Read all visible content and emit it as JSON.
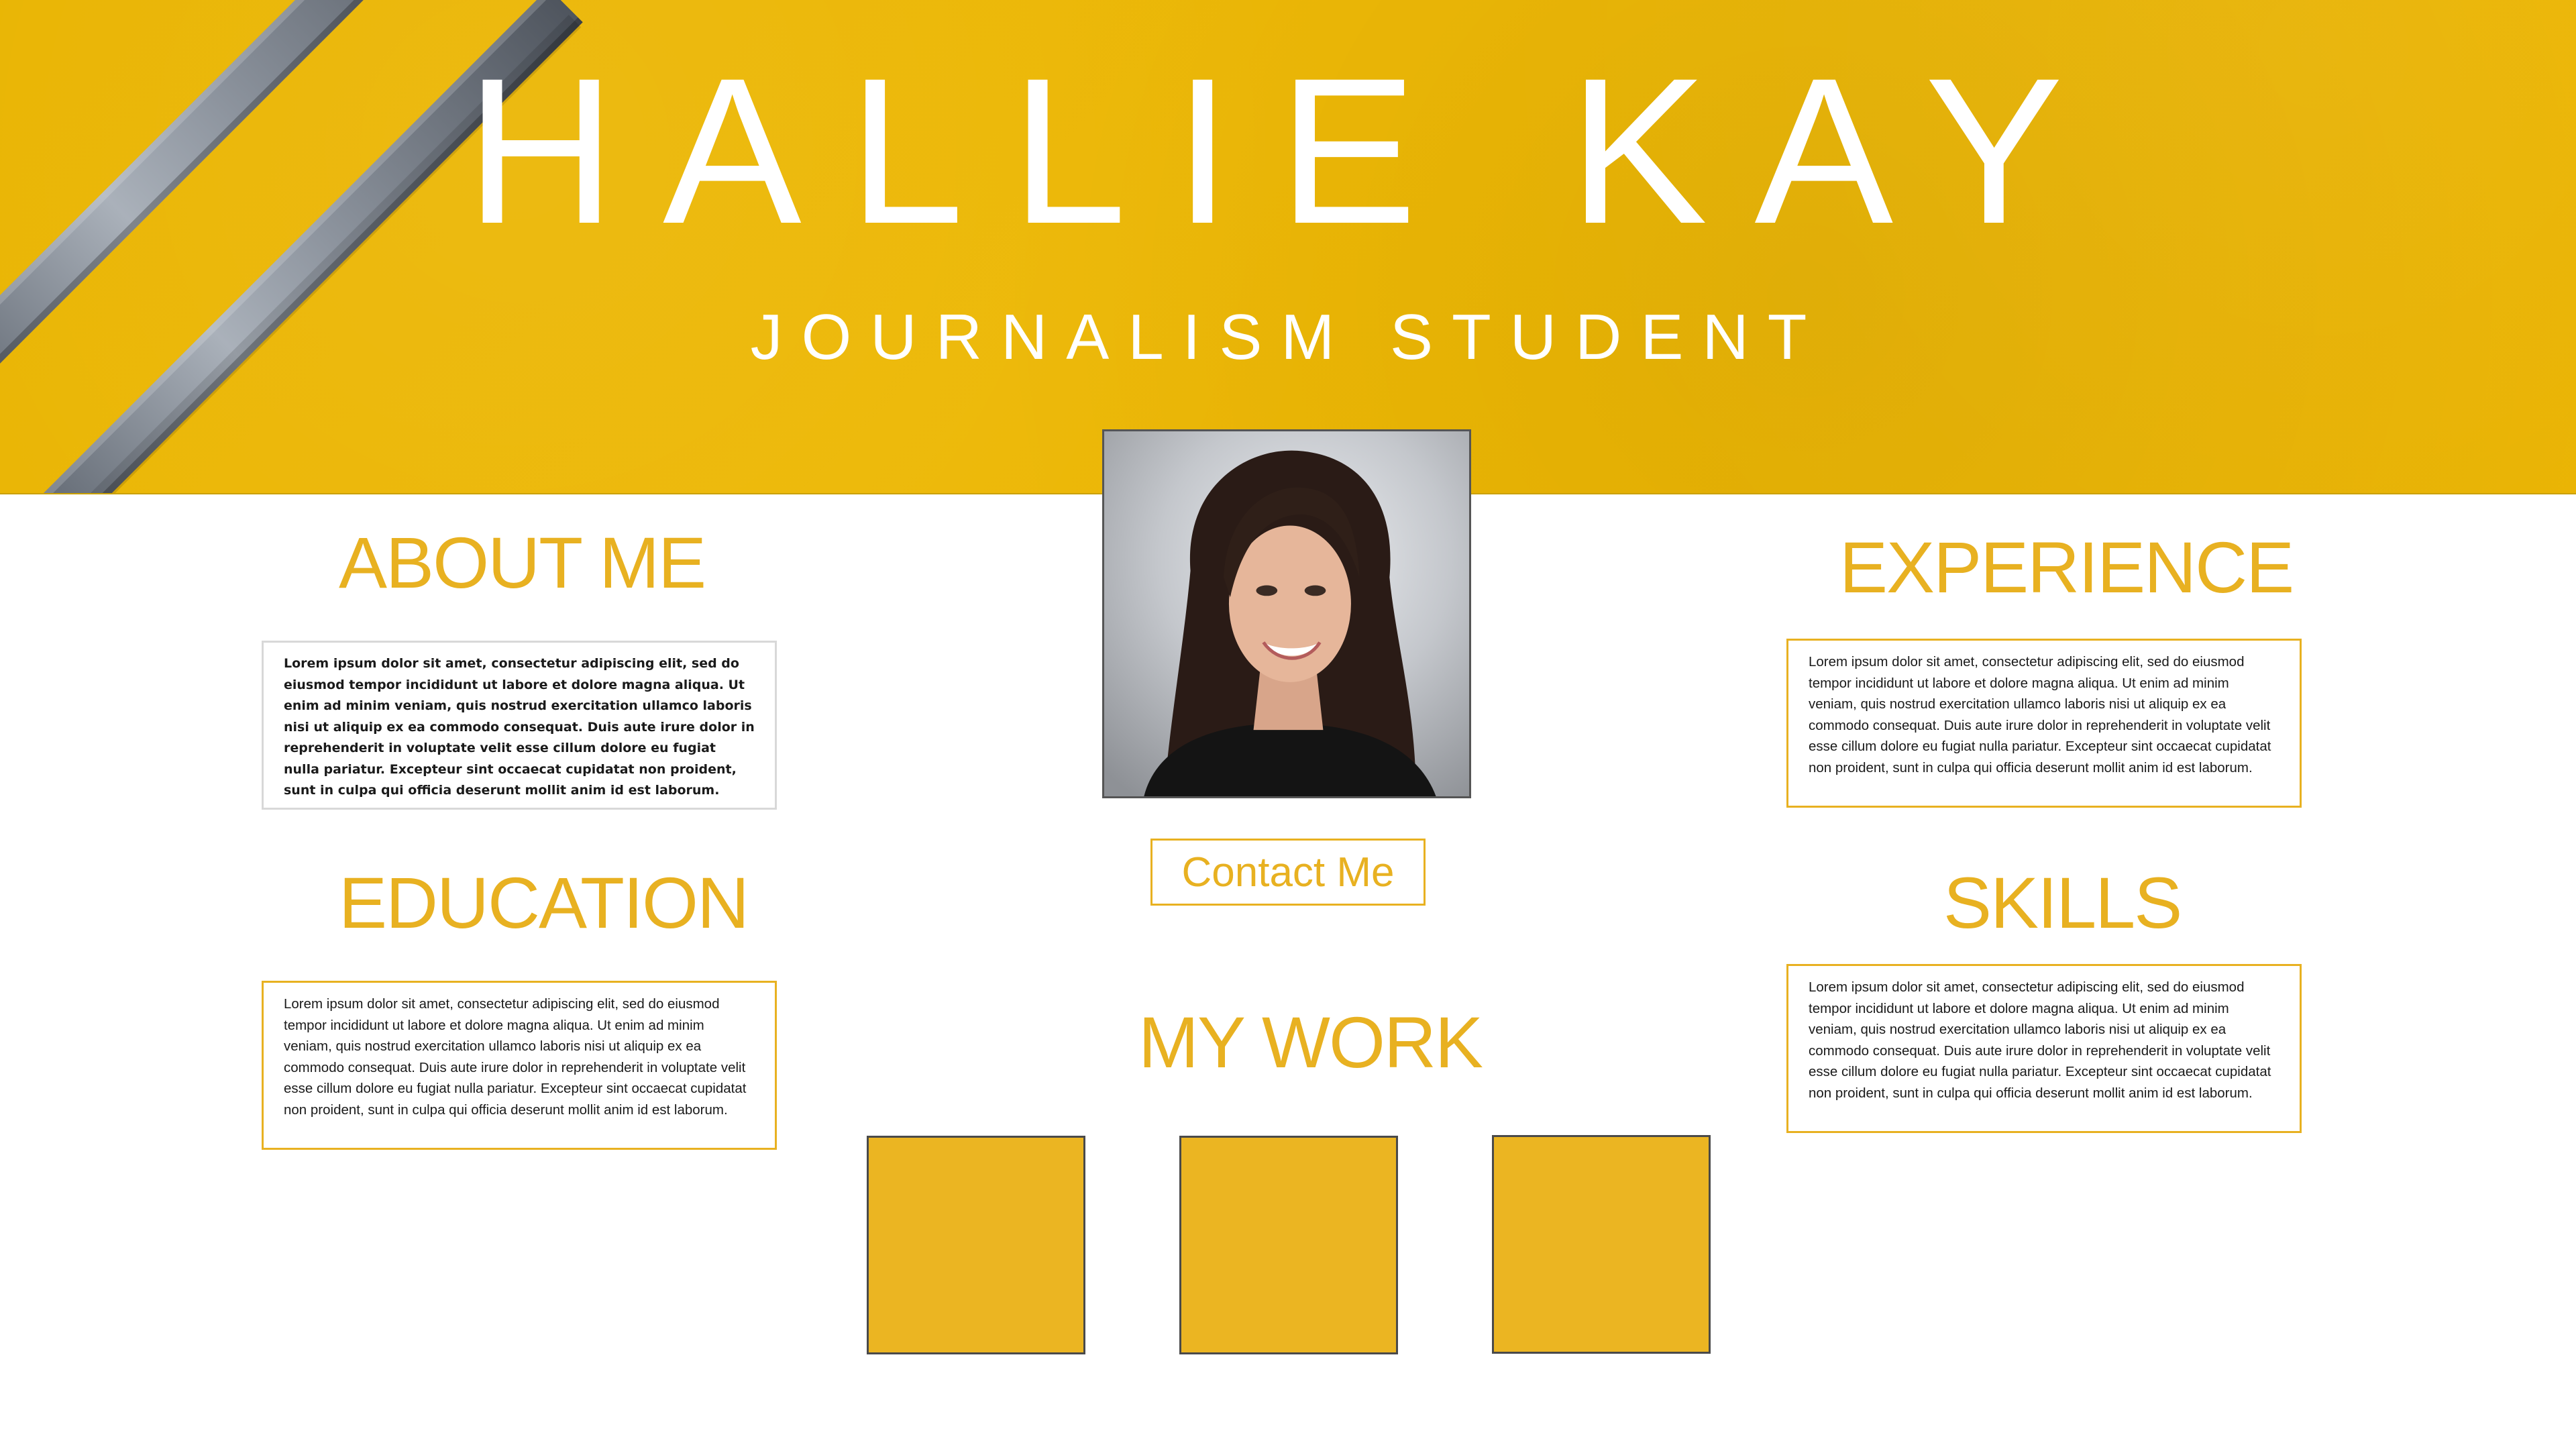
{
  "header": {
    "name": "HALLIE KAY",
    "subtitle": "JOURNALISM STUDENT"
  },
  "sections": {
    "about": {
      "heading": "ABOUT ME",
      "text": "Lorem ipsum dolor sit amet, consectetur adipiscing elit, sed do eiusmod tempor incididunt ut labore et dolore magna aliqua. Ut enim ad minim veniam, quis nostrud exercitation ullamco laboris nisi ut aliquip ex ea commodo consequat. Duis aute irure dolor in reprehenderit in voluptate velit esse cillum dolore eu fugiat nulla pariatur. Excepteur sint occaecat cupidatat non proident, sunt in culpa qui officia deserunt mollit anim id est laborum."
    },
    "education": {
      "heading": "EDUCATION",
      "text": "Lorem ipsum dolor sit amet, consectetur adipiscing elit, sed do eiusmod tempor incididunt ut labore et dolore magna aliqua. Ut enim ad minim veniam, quis nostrud exercitation ullamco laboris nisi ut aliquip ex ea commodo consequat. Duis aute irure dolor in reprehenderit in voluptate velit esse cillum dolore eu fugiat nulla pariatur. Excepteur sint occaecat cupidatat non proident, sunt in culpa qui officia deserunt mollit anim id est laborum."
    },
    "experience": {
      "heading": "EXPERIENCE",
      "text": "Lorem ipsum dolor sit amet, consectetur adipiscing elit, sed do eiusmod tempor incididunt ut labore et dolore magna aliqua. Ut enim ad minim veniam, quis nostrud exercitation ullamco laboris nisi ut aliquip ex ea commodo consequat. Duis aute irure dolor in reprehenderit in voluptate velit esse cillum dolore eu fugiat nulla pariatur. Excepteur sint occaecat cupidatat non proident, sunt in culpa qui officia deserunt mollit anim id est laborum."
    },
    "skills": {
      "heading": "SKILLS",
      "text": "Lorem ipsum dolor sit amet, consectetur adipiscing elit, sed do eiusmod tempor incididunt ut labore et dolore magna aliqua. Ut enim ad minim veniam, quis nostrud exercitation ullamco laboris nisi ut aliquip ex ea commodo consequat. Duis aute irure dolor in reprehenderit in voluptate velit esse cillum dolore eu fugiat nulla pariatur. Excepteur sint occaecat cupidatat non proident, sunt in culpa qui officia deserunt mollit anim id est laborum."
    },
    "work": {
      "heading": "MY WORK"
    }
  },
  "contact": {
    "label": "Contact Me"
  },
  "colors": {
    "accent": "#e8b121",
    "banner": "#edb806",
    "tile": "#ebb522"
  },
  "icons": {
    "banner_decoration": "pencils-icon",
    "profile": "profile-photo"
  }
}
